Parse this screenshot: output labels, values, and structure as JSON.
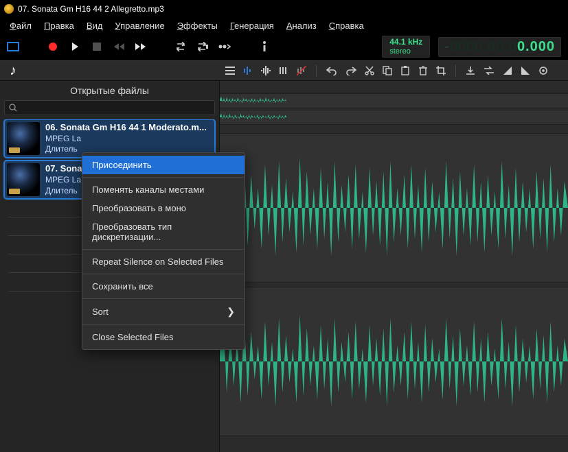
{
  "window": {
    "title": "07. Sonata Gm H16 44 2 Allegretto.mp3"
  },
  "menu": {
    "items": [
      "Файл",
      "Правка",
      "Вид",
      "Управление",
      "Эффекты",
      "Генерация",
      "Анализ",
      "Справка"
    ]
  },
  "display": {
    "sample_rate": "44.1 kHz",
    "channels": "stereo",
    "time_neg": "-",
    "time_gray": "0000:00:0",
    "time_cur": "0.000"
  },
  "side": {
    "title": "Открытые файлы",
    "search_placeholder": "",
    "files": [
      {
        "name": "06. Sonata Gm H16 44 1 Moderato.m...",
        "codec": "MPEG La",
        "duration": "Длитель"
      },
      {
        "name": "07. Sona",
        "codec": "MPEG La",
        "duration": "Длитель"
      }
    ]
  },
  "context_menu": {
    "items": [
      {
        "label": "Присоединить",
        "highlight": true
      },
      {
        "sep": true
      },
      {
        "label": "Поменять каналы местами"
      },
      {
        "label": "Преобразовать в моно"
      },
      {
        "label": "Преобразовать тип дискретизации..."
      },
      {
        "sep": true
      },
      {
        "label": "Repeat Silence on Selected Files"
      },
      {
        "sep": true
      },
      {
        "label": "Сохранить все"
      },
      {
        "sep": true
      },
      {
        "label": "Sort",
        "submenu": true
      },
      {
        "sep": true
      },
      {
        "label": "Close Selected Files"
      }
    ]
  },
  "icons": {
    "transport": [
      "bounds",
      "record",
      "play",
      "stop",
      "rew",
      "ffwd",
      "loop",
      "loop-sel",
      "to-end",
      "info"
    ],
    "tools": [
      "ch-list",
      "bars-a",
      "bars-b",
      "bars-c",
      "bars-x",
      "undo",
      "redo",
      "cut",
      "copy",
      "paste",
      "delete",
      "crop",
      "import",
      "flip",
      "fade-in",
      "fade-out",
      "settings"
    ]
  },
  "colors": {
    "wave": "#2fb486",
    "wave_light": "#3de0a0",
    "accent": "#1f6fd6"
  }
}
